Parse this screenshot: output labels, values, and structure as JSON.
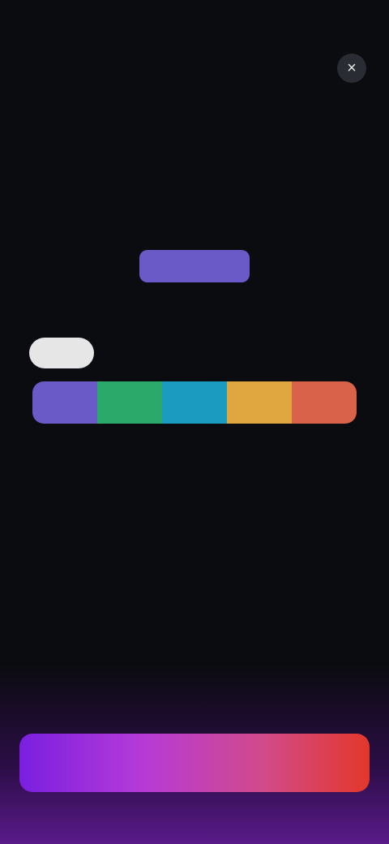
{
  "status_bar": {
    "time": "",
    "icons": ""
  },
  "close_label": "×",
  "header": {
    "title": "",
    "value": "",
    "level": ""
  },
  "scale": {
    "pointer_label": "",
    "segments": [
      {
        "label": "",
        "color": "#6a5ac8"
      },
      {
        "label": "",
        "color": "#2aa96a"
      },
      {
        "label": "",
        "color": "#1a9bbf"
      },
      {
        "label": "",
        "color": "#e0a640"
      },
      {
        "label": "",
        "color": "#d8624a"
      }
    ]
  },
  "section": {
    "title": "",
    "detail_1": "",
    "detail_2": "",
    "description": ""
  },
  "cta": {
    "label": ""
  },
  "colors": {
    "background": "#0b0c10",
    "accent": "#6a5ac8",
    "cta_start": "#7a1fe0",
    "cta_end": "#e2382a"
  }
}
